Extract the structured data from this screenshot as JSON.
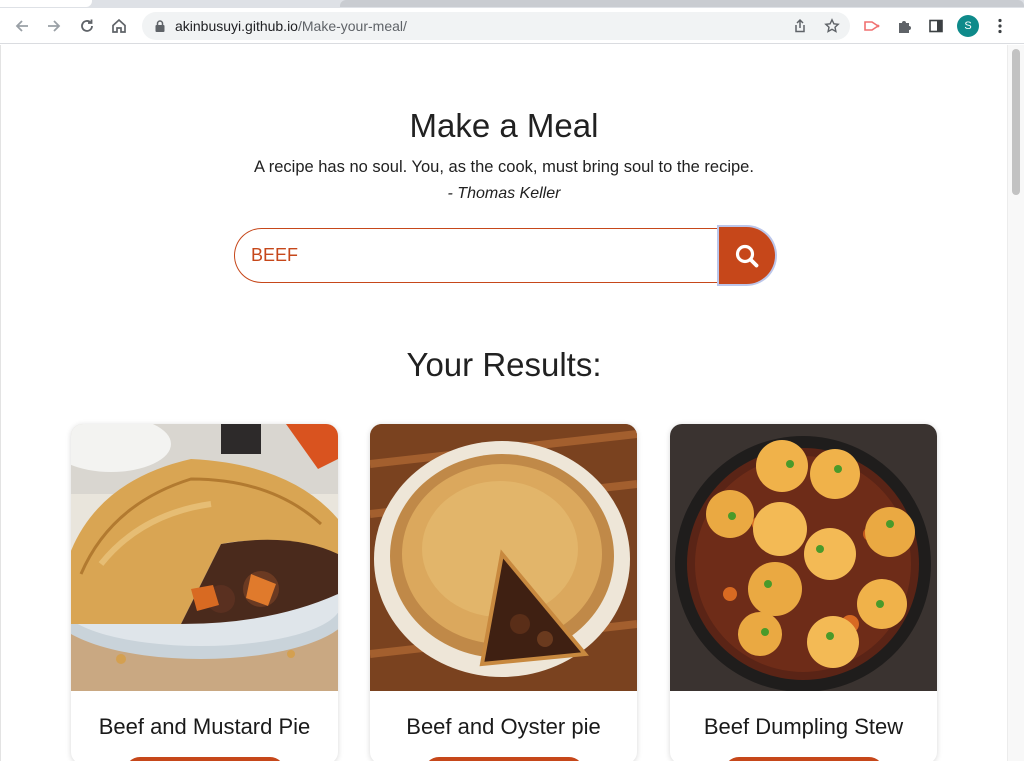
{
  "browser": {
    "url_host": "akinbusuyi.github.io",
    "url_path": "/Make-your-meal/",
    "profile_initial": "S",
    "icons": [
      "back-arrow-icon",
      "forward-arrow-icon",
      "reload-icon",
      "home-icon",
      "lock-icon",
      "share-icon",
      "bookmark-star-icon",
      "extension-puzzle-icon",
      "side-panel-icon",
      "menu-dots-icon"
    ]
  },
  "page": {
    "title": "Make a Meal",
    "quote": "A recipe has no soul. You, as the cook, must bring soul to the recipe.",
    "author": "- Thomas Keller",
    "results_heading": "Your Results:"
  },
  "search": {
    "value": "BEEF",
    "button_icon": "search-icon"
  },
  "recipes": [
    {
      "title": "Beef and Mustard Pie"
    },
    {
      "title": "Beef and Oyster pie"
    },
    {
      "title": "Beef Dumpling Stew"
    }
  ],
  "colors": {
    "accent": "#c6471a",
    "focus_ring": "#bcc6ea"
  }
}
